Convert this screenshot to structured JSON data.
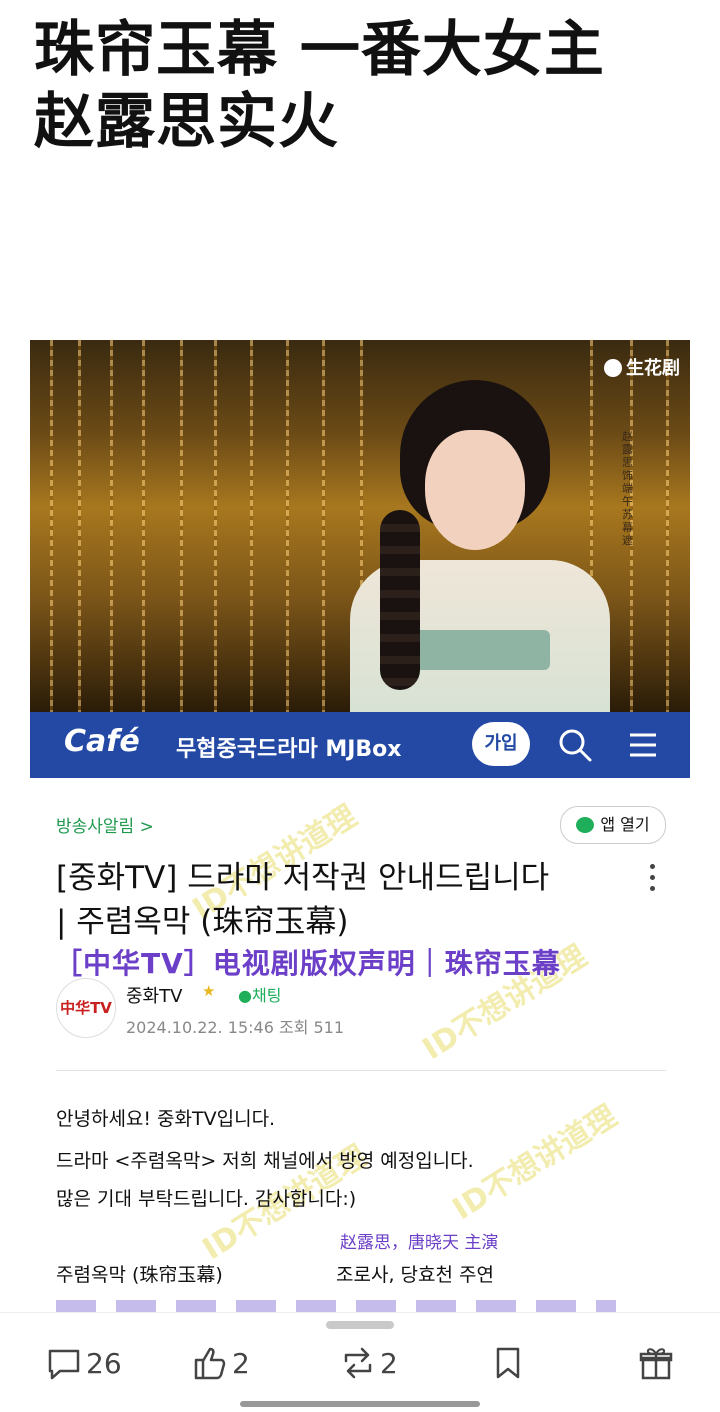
{
  "headline": {
    "line1": "珠帘玉幕 一番大女主",
    "line2": "赵露思实火"
  },
  "image": {
    "logo_text": "生花剧",
    "vertical_caption": "赵露思 饰 端午 苏幕遮"
  },
  "cafe": {
    "logo": "Café",
    "name": "무협중국드라마 MJBox",
    "join_label": "가입",
    "brand_color": "#2349a5"
  },
  "post": {
    "board_link": "방송사알림 >",
    "app_open_label": "앱 열기",
    "title_line1": "[중화TV] 드라마 저작권 안내드립니다",
    "title_line2": "| 주렴옥막 (珠帘玉幕)",
    "cn_annotation": "［中华TV］电视剧版权声明｜珠帘玉幕",
    "avatar_text": "中华TV",
    "author": "중화TV",
    "chat_label": "채팅",
    "meta": "2024.10.22. 15:46  조회 511",
    "watermark": "ID不想讲道理",
    "body": [
      "안녕하세요! 중화TV입니다.",
      "드라마 <주렴옥막> 저희 채널에서 방영 예정입니다.",
      "많은 기대 부탁드립니다. 감사합니다:)"
    ],
    "cast_annotation": "赵露思，唐晓天 主演",
    "drama_title": "주렴옥막 (珠帘玉幕)",
    "drama_cast": "조로사, 당효천 주연"
  },
  "actions": {
    "comments": "26",
    "likes": "2",
    "reposts": "2"
  }
}
